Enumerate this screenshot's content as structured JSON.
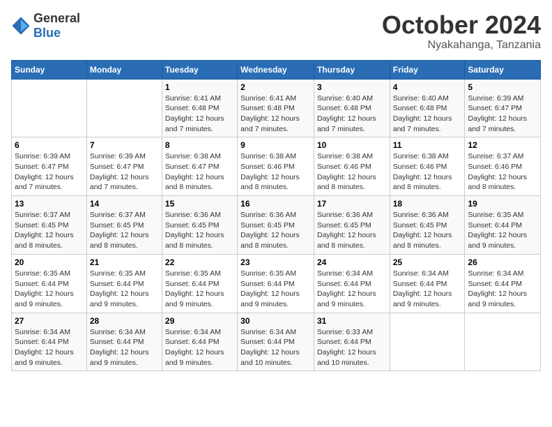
{
  "logo": {
    "general": "General",
    "blue": "Blue"
  },
  "title": "October 2024",
  "subtitle": "Nyakahanga, Tanzania",
  "days_of_week": [
    "Sunday",
    "Monday",
    "Tuesday",
    "Wednesday",
    "Thursday",
    "Friday",
    "Saturday"
  ],
  "weeks": [
    [
      {
        "day": "",
        "detail": ""
      },
      {
        "day": "",
        "detail": ""
      },
      {
        "day": "1",
        "detail": "Sunrise: 6:41 AM\nSunset: 6:48 PM\nDaylight: 12 hours and 7 minutes."
      },
      {
        "day": "2",
        "detail": "Sunrise: 6:41 AM\nSunset: 6:48 PM\nDaylight: 12 hours and 7 minutes."
      },
      {
        "day": "3",
        "detail": "Sunrise: 6:40 AM\nSunset: 6:48 PM\nDaylight: 12 hours and 7 minutes."
      },
      {
        "day": "4",
        "detail": "Sunrise: 6:40 AM\nSunset: 6:48 PM\nDaylight: 12 hours and 7 minutes."
      },
      {
        "day": "5",
        "detail": "Sunrise: 6:39 AM\nSunset: 6:47 PM\nDaylight: 12 hours and 7 minutes."
      }
    ],
    [
      {
        "day": "6",
        "detail": "Sunrise: 6:39 AM\nSunset: 6:47 PM\nDaylight: 12 hours and 7 minutes."
      },
      {
        "day": "7",
        "detail": "Sunrise: 6:39 AM\nSunset: 6:47 PM\nDaylight: 12 hours and 7 minutes."
      },
      {
        "day": "8",
        "detail": "Sunrise: 6:38 AM\nSunset: 6:47 PM\nDaylight: 12 hours and 8 minutes."
      },
      {
        "day": "9",
        "detail": "Sunrise: 6:38 AM\nSunset: 6:46 PM\nDaylight: 12 hours and 8 minutes."
      },
      {
        "day": "10",
        "detail": "Sunrise: 6:38 AM\nSunset: 6:46 PM\nDaylight: 12 hours and 8 minutes."
      },
      {
        "day": "11",
        "detail": "Sunrise: 6:38 AM\nSunset: 6:46 PM\nDaylight: 12 hours and 8 minutes."
      },
      {
        "day": "12",
        "detail": "Sunrise: 6:37 AM\nSunset: 6:46 PM\nDaylight: 12 hours and 8 minutes."
      }
    ],
    [
      {
        "day": "13",
        "detail": "Sunrise: 6:37 AM\nSunset: 6:45 PM\nDaylight: 12 hours and 8 minutes."
      },
      {
        "day": "14",
        "detail": "Sunrise: 6:37 AM\nSunset: 6:45 PM\nDaylight: 12 hours and 8 minutes."
      },
      {
        "day": "15",
        "detail": "Sunrise: 6:36 AM\nSunset: 6:45 PM\nDaylight: 12 hours and 8 minutes."
      },
      {
        "day": "16",
        "detail": "Sunrise: 6:36 AM\nSunset: 6:45 PM\nDaylight: 12 hours and 8 minutes."
      },
      {
        "day": "17",
        "detail": "Sunrise: 6:36 AM\nSunset: 6:45 PM\nDaylight: 12 hours and 8 minutes."
      },
      {
        "day": "18",
        "detail": "Sunrise: 6:36 AM\nSunset: 6:45 PM\nDaylight: 12 hours and 8 minutes."
      },
      {
        "day": "19",
        "detail": "Sunrise: 6:35 AM\nSunset: 6:44 PM\nDaylight: 12 hours and 9 minutes."
      }
    ],
    [
      {
        "day": "20",
        "detail": "Sunrise: 6:35 AM\nSunset: 6:44 PM\nDaylight: 12 hours and 9 minutes."
      },
      {
        "day": "21",
        "detail": "Sunrise: 6:35 AM\nSunset: 6:44 PM\nDaylight: 12 hours and 9 minutes."
      },
      {
        "day": "22",
        "detail": "Sunrise: 6:35 AM\nSunset: 6:44 PM\nDaylight: 12 hours and 9 minutes."
      },
      {
        "day": "23",
        "detail": "Sunrise: 6:35 AM\nSunset: 6:44 PM\nDaylight: 12 hours and 9 minutes."
      },
      {
        "day": "24",
        "detail": "Sunrise: 6:34 AM\nSunset: 6:44 PM\nDaylight: 12 hours and 9 minutes."
      },
      {
        "day": "25",
        "detail": "Sunrise: 6:34 AM\nSunset: 6:44 PM\nDaylight: 12 hours and 9 minutes."
      },
      {
        "day": "26",
        "detail": "Sunrise: 6:34 AM\nSunset: 6:44 PM\nDaylight: 12 hours and 9 minutes."
      }
    ],
    [
      {
        "day": "27",
        "detail": "Sunrise: 6:34 AM\nSunset: 6:44 PM\nDaylight: 12 hours and 9 minutes."
      },
      {
        "day": "28",
        "detail": "Sunrise: 6:34 AM\nSunset: 6:44 PM\nDaylight: 12 hours and 9 minutes."
      },
      {
        "day": "29",
        "detail": "Sunrise: 6:34 AM\nSunset: 6:44 PM\nDaylight: 12 hours and 9 minutes."
      },
      {
        "day": "30",
        "detail": "Sunrise: 6:34 AM\nSunset: 6:44 PM\nDaylight: 12 hours and 10 minutes."
      },
      {
        "day": "31",
        "detail": "Sunrise: 6:33 AM\nSunset: 6:44 PM\nDaylight: 12 hours and 10 minutes."
      },
      {
        "day": "",
        "detail": ""
      },
      {
        "day": "",
        "detail": ""
      }
    ]
  ]
}
